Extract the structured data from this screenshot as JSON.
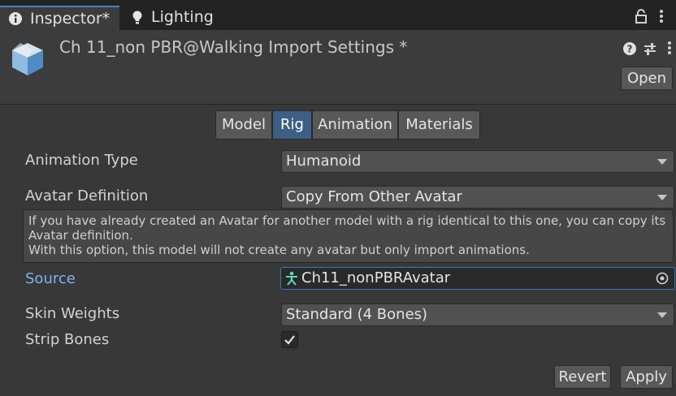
{
  "tabs": [
    {
      "label": "Inspector*",
      "icon": "info-icon",
      "active": true
    },
    {
      "label": "Lighting",
      "icon": "lightbulb-icon",
      "active": false
    }
  ],
  "header": {
    "title": "Ch 11_non PBR@Walking Import Settings *",
    "open_label": "Open"
  },
  "toolbar": {
    "tabs": [
      "Model",
      "Rig",
      "Animation",
      "Materials"
    ],
    "active": "Rig"
  },
  "fields": {
    "animation_type": {
      "label": "Animation Type",
      "value": "Humanoid"
    },
    "avatar_definition": {
      "label": "Avatar Definition",
      "value": "Copy From Other Avatar"
    },
    "help_text": "If you have already created an Avatar for another model with a rig identical to this one, you can copy its Avatar definition.\nWith this option, this model will not create any avatar but only import animations.",
    "source": {
      "label": "Source",
      "value": "Ch11_nonPBRAvatar"
    },
    "skin_weights": {
      "label": "Skin Weights",
      "value": "Standard (4 Bones)"
    },
    "strip_bones": {
      "label": "Strip Bones",
      "checked": true
    }
  },
  "footer": {
    "revert_label": "Revert",
    "apply_label": "Apply"
  },
  "colors": {
    "active_tab": "#3d5f86",
    "source_label": "#7fb2ef",
    "background": "#383838"
  }
}
